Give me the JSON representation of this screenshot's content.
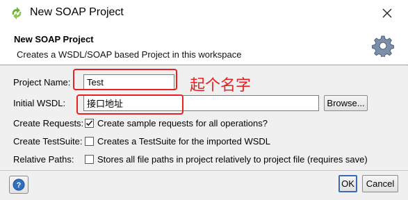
{
  "window": {
    "title": "New SOAP Project",
    "close_label": "close"
  },
  "header": {
    "title": "New SOAP Project",
    "description": "Creates a WSDL/SOAP based Project in this workspace"
  },
  "form": {
    "project_name": {
      "label": "Project Name:",
      "value": "Test"
    },
    "initial_wsdl": {
      "label": "Initial WSDL:",
      "value": "接口地址",
      "browse_label": "Browse..."
    },
    "create_requests": {
      "label": "Create Requests:",
      "checked": true,
      "option": "Create sample requests for all operations?"
    },
    "create_testsuite": {
      "label": "Create TestSuite:",
      "checked": false,
      "option": "Creates a TestSuite for the imported WSDL"
    },
    "relative_paths": {
      "label": "Relative Paths:",
      "checked": false,
      "option": "Stores all file paths in project relatively to project file (requires save)"
    }
  },
  "annotation": {
    "text": "起个名字",
    "color": "#e82020"
  },
  "footer": {
    "help_label": "?",
    "ok_label": "OK",
    "cancel_label": "Cancel"
  },
  "icons": {
    "app": "soapui-logo-icon",
    "header": "gear-icon",
    "help": "help-icon",
    "close": "close-icon",
    "check": "checkmark-icon"
  }
}
